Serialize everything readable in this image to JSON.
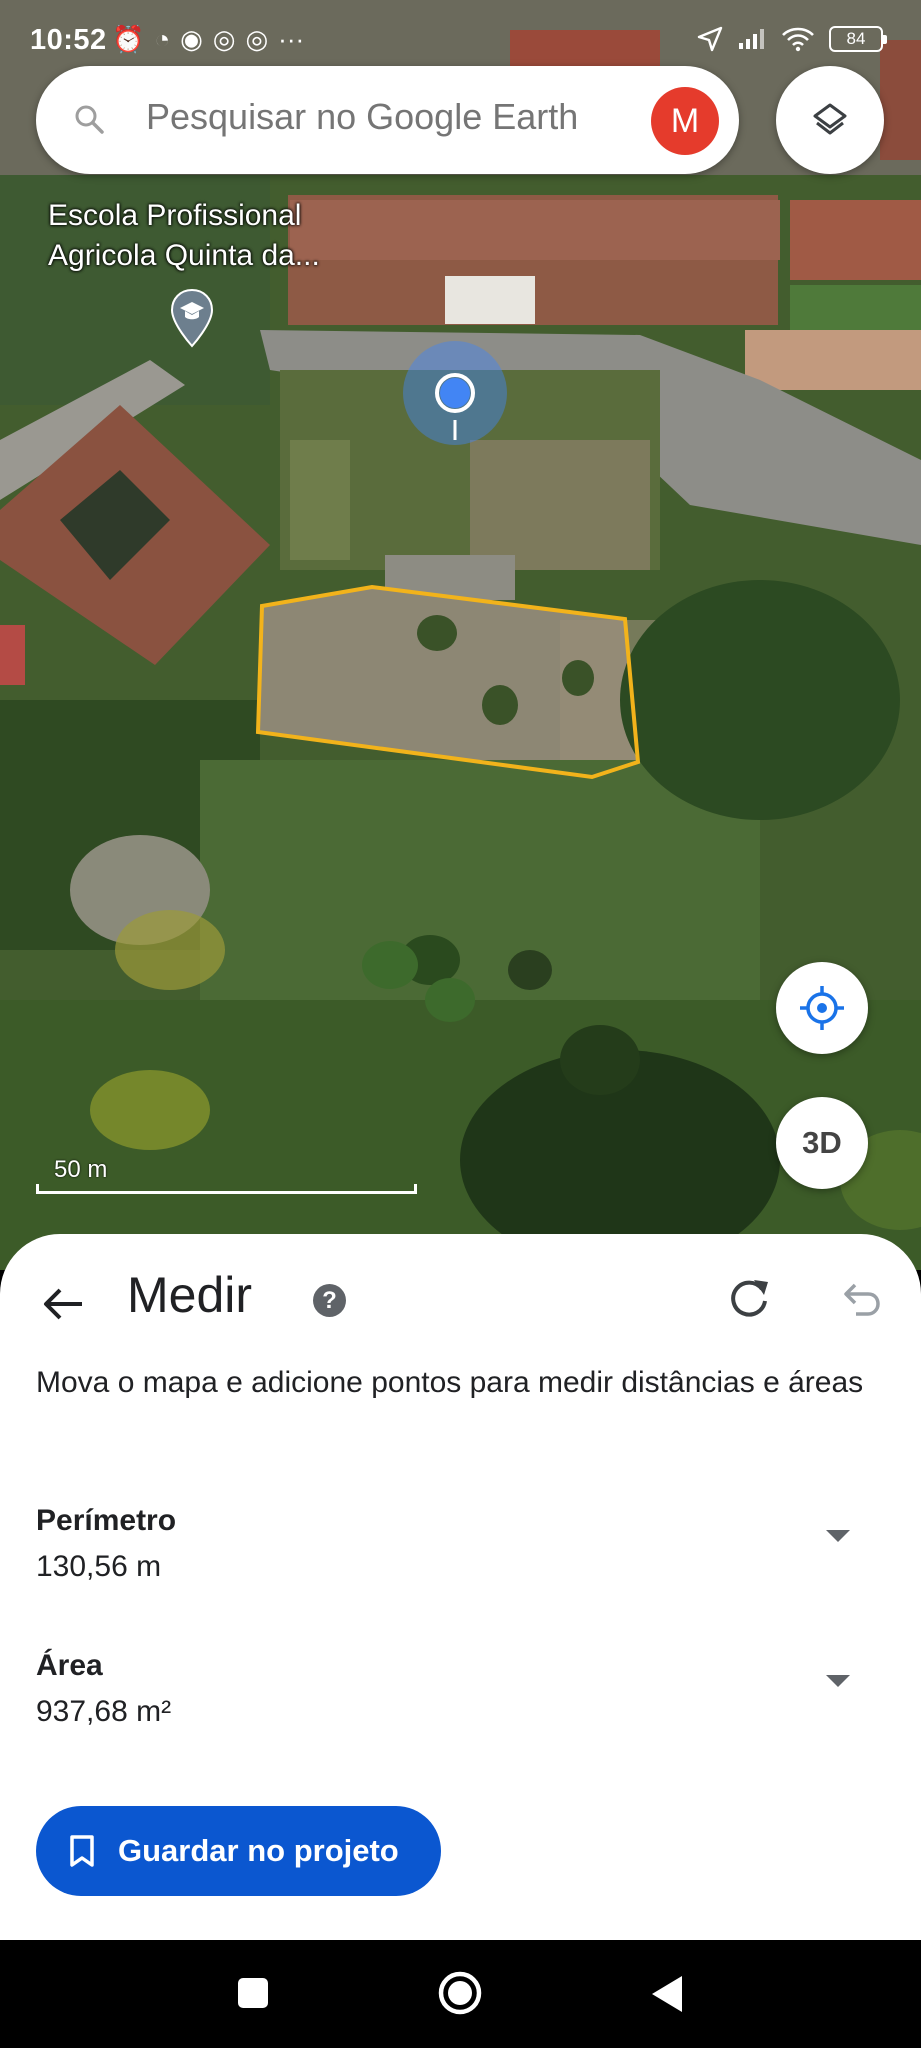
{
  "status_bar": {
    "time": "10:52",
    "battery": "84"
  },
  "search": {
    "placeholder": "Pesquisar no Google Earth",
    "avatar_letter": "M"
  },
  "map": {
    "place_label_line1": "Escola Profissional",
    "place_label_line2": "Agricola Quinta da...",
    "scale_label": "50 m",
    "view_3d_label": "3D",
    "outline_color": "#f2b31b"
  },
  "sheet": {
    "title": "Medir",
    "help_glyph": "?",
    "description": "Mova o mapa e adicione pontos para medir distâncias e áreas",
    "perimeter_label": "Perímetro",
    "perimeter_value": "130,56 m",
    "area_label": "Área",
    "area_value": "937,68 m²",
    "save_label": "Guardar no projeto"
  },
  "colors": {
    "accent": "#0b57d0",
    "avatar": "#e53b2c",
    "location_dot": "#4285f4"
  },
  "icons": [
    "search-icon",
    "layers-icon",
    "my-location-icon",
    "back-arrow-icon",
    "help-icon",
    "redo-icon",
    "undo-icon",
    "bookmark-icon",
    "graduation-cap-icon"
  ]
}
